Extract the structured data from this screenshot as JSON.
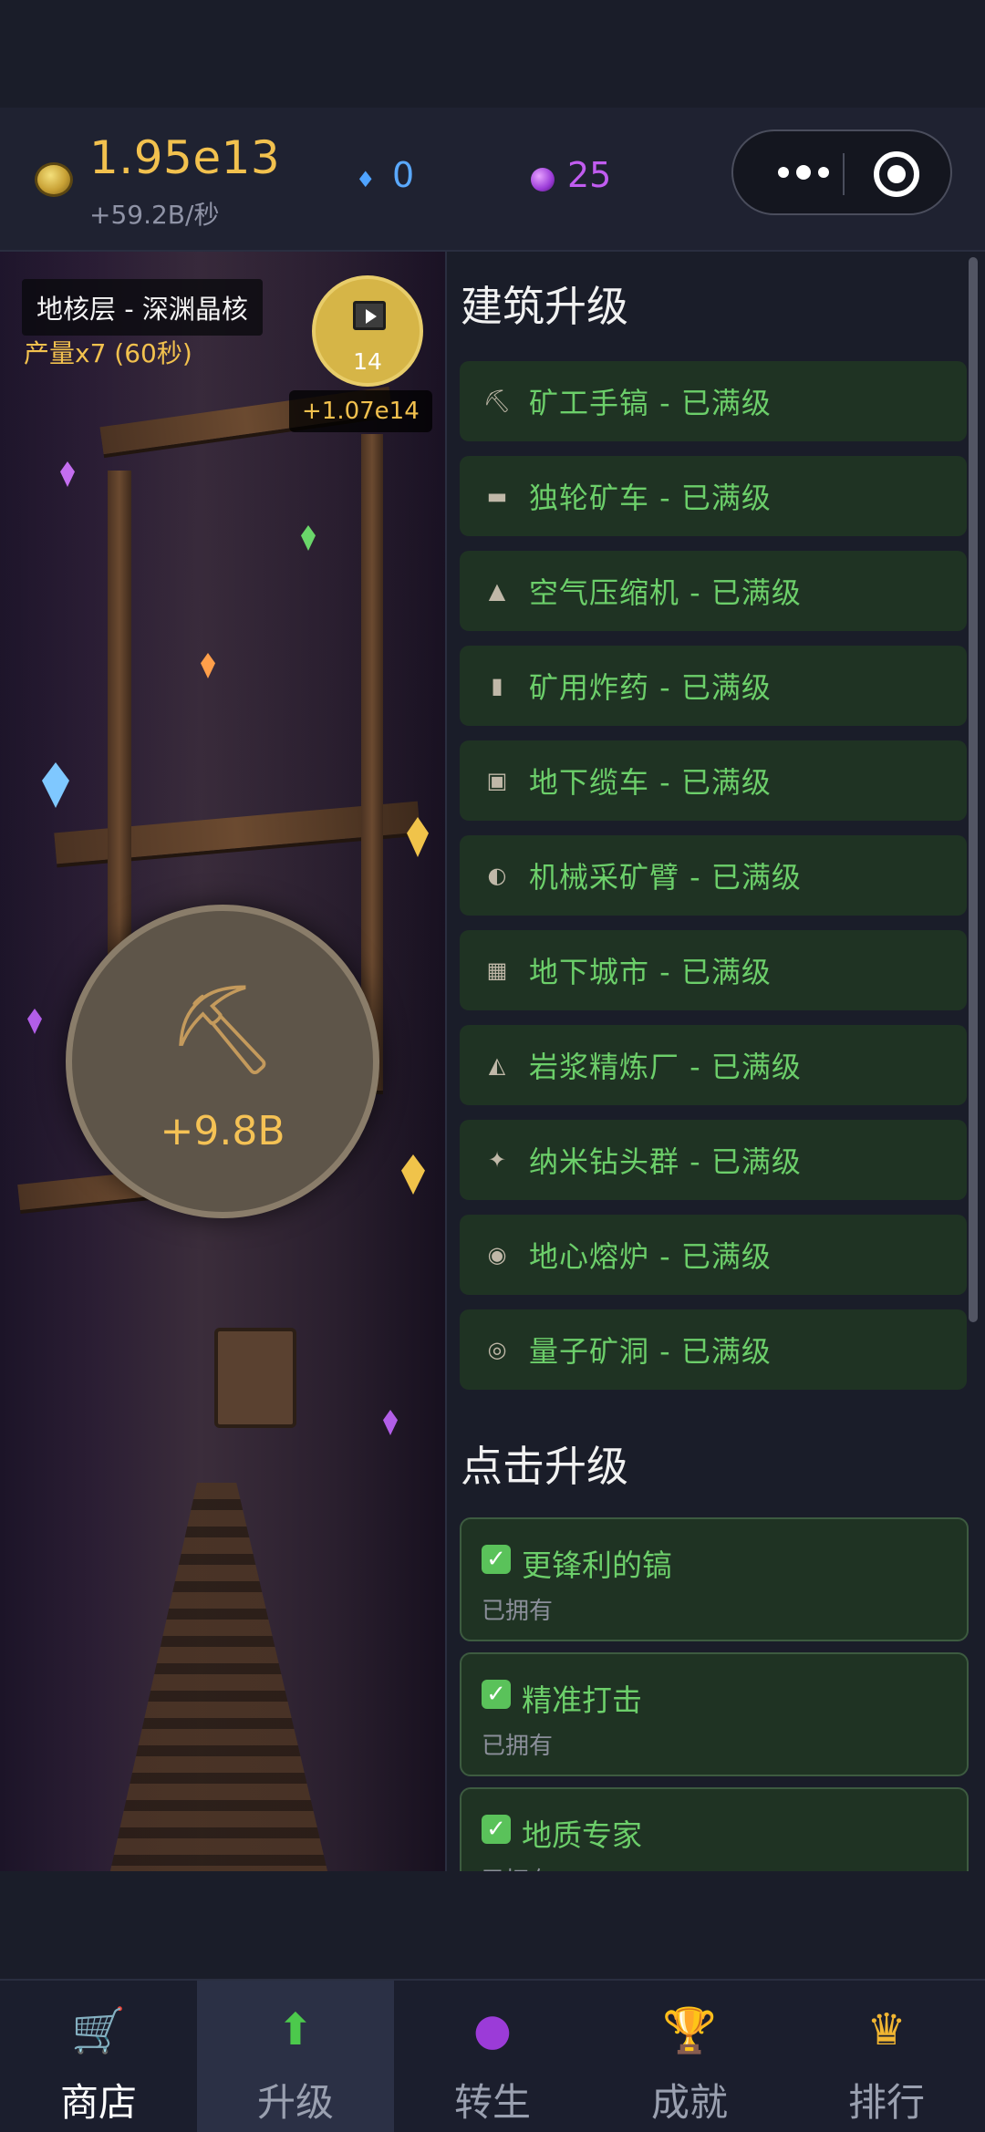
{
  "resources": {
    "gold_icon": "gold-ore-icon",
    "gold_amount": "1.95e13",
    "gold_rate": "+59.2B/秒",
    "gem_icon": "blue-gem-icon",
    "gems": "0",
    "orb_icon": "purple-orb-icon",
    "orbs": "25"
  },
  "capsule": {
    "more": "more-dots-icon",
    "close": "target-close-icon"
  },
  "scene": {
    "level_name": "地核层 - 深渊晶核",
    "level_bonus": "产量x7 (60秒)",
    "video_icon": "film-play-icon",
    "video_count": "14",
    "video_reward": "+1.07e14",
    "tap_icon": "pickaxe-icon",
    "tap_value": "+9.8B"
  },
  "buildings": {
    "title": "建筑升级",
    "items": [
      {
        "icon": "⛏",
        "label": "矿工手镐 - 已满级"
      },
      {
        "icon": "▬",
        "label": "独轮矿车 - 已满级"
      },
      {
        "icon": "▲",
        "label": "空气压缩机 - 已满级"
      },
      {
        "icon": "▮",
        "label": "矿用炸药 - 已满级"
      },
      {
        "icon": "▣",
        "label": "地下缆车 - 已满级"
      },
      {
        "icon": "◐",
        "label": "机械采矿臂 - 已满级"
      },
      {
        "icon": "▦",
        "label": "地下城市 - 已满级"
      },
      {
        "icon": "◭",
        "label": "岩浆精炼厂 - 已满级"
      },
      {
        "icon": "✦",
        "label": "纳米钻头群 - 已满级"
      },
      {
        "icon": "◉",
        "label": "地心熔炉 - 已满级"
      },
      {
        "icon": "◎",
        "label": "量子矿洞 - 已满级"
      }
    ]
  },
  "click_upgrades": {
    "title": "点击升级",
    "items": [
      {
        "check": "✓",
        "name": "更锋利的镐",
        "status": "已拥有"
      },
      {
        "check": "✓",
        "name": "精准打击",
        "status": "已拥有"
      },
      {
        "check": "✓",
        "name": "地质专家",
        "status": "已拥有"
      }
    ]
  },
  "nav": [
    {
      "icon": "🛒",
      "label": "商店"
    },
    {
      "icon": "⬆",
      "label": "升级"
    },
    {
      "icon": "●",
      "label": "转生"
    },
    {
      "icon": "🏆",
      "label": "成就"
    },
    {
      "icon": "♛",
      "label": "排行"
    }
  ],
  "colors": {
    "gold": "#f2c14e",
    "gem": "#5aa9ff",
    "orb": "#c15cf0",
    "maxed_green": "#6ccf6a",
    "row_bg": "#1f3323"
  }
}
